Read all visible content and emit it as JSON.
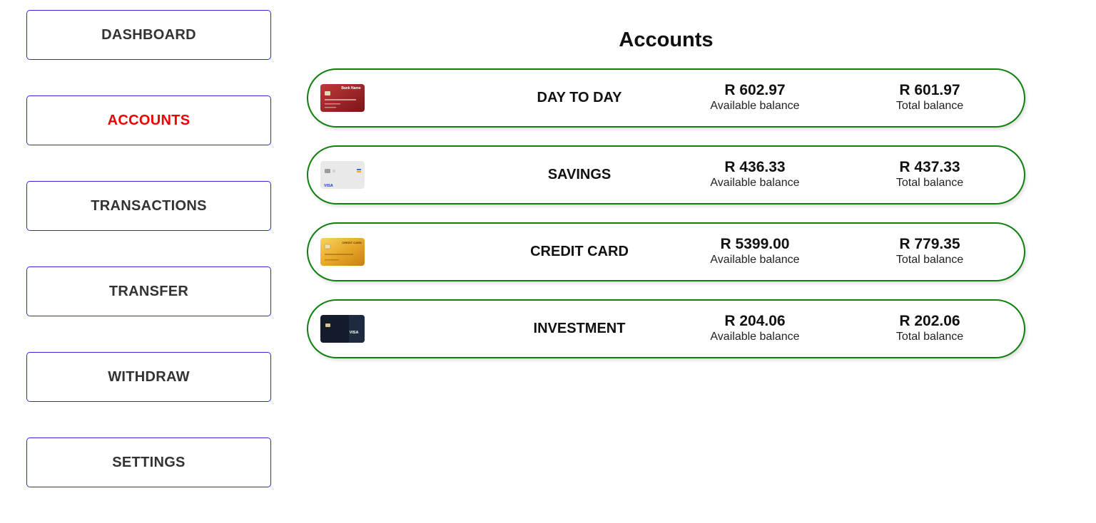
{
  "sidebar": {
    "items": [
      {
        "label": "DASHBOARD"
      },
      {
        "label": "ACCOUNTS"
      },
      {
        "label": "TRANSACTIONS"
      },
      {
        "label": "TRANSFER"
      },
      {
        "label": "WITHDRAW"
      },
      {
        "label": "SETTINGS"
      }
    ],
    "active_item": "ACCOUNTS",
    "active_color": "#ee0000",
    "border_color": "#2b2bd6"
  },
  "main": {
    "title": "Accounts",
    "accounts": [
      {
        "name": "DAY TO DAY",
        "card_icon": "red-card-icon",
        "card_text": "Bank Name",
        "available_balance": "R 602.97",
        "available_label": "Available balance",
        "total_balance": "R 601.97",
        "total_label": "Total balance"
      },
      {
        "name": "SAVINGS",
        "card_icon": "white-visa-card-icon",
        "card_text": "VISA",
        "available_balance": "R 436.33",
        "available_label": "Available balance",
        "total_balance": "R 437.33",
        "total_label": "Total balance"
      },
      {
        "name": "CREDIT CARD",
        "card_icon": "gold-card-icon",
        "card_text": "CREDIT CARD",
        "available_balance": "R 5399.00",
        "available_label": "Available balance",
        "total_balance": "R 779.35",
        "total_label": "Total balance"
      },
      {
        "name": "INVESTMENT",
        "card_icon": "dark-visa-card-icon",
        "card_text": "VISA",
        "available_balance": "R 204.06",
        "available_label": "Available balance",
        "total_balance": "R 202.06",
        "total_label": "Total balance"
      }
    ],
    "row_border_color": "#0f7f0f"
  }
}
